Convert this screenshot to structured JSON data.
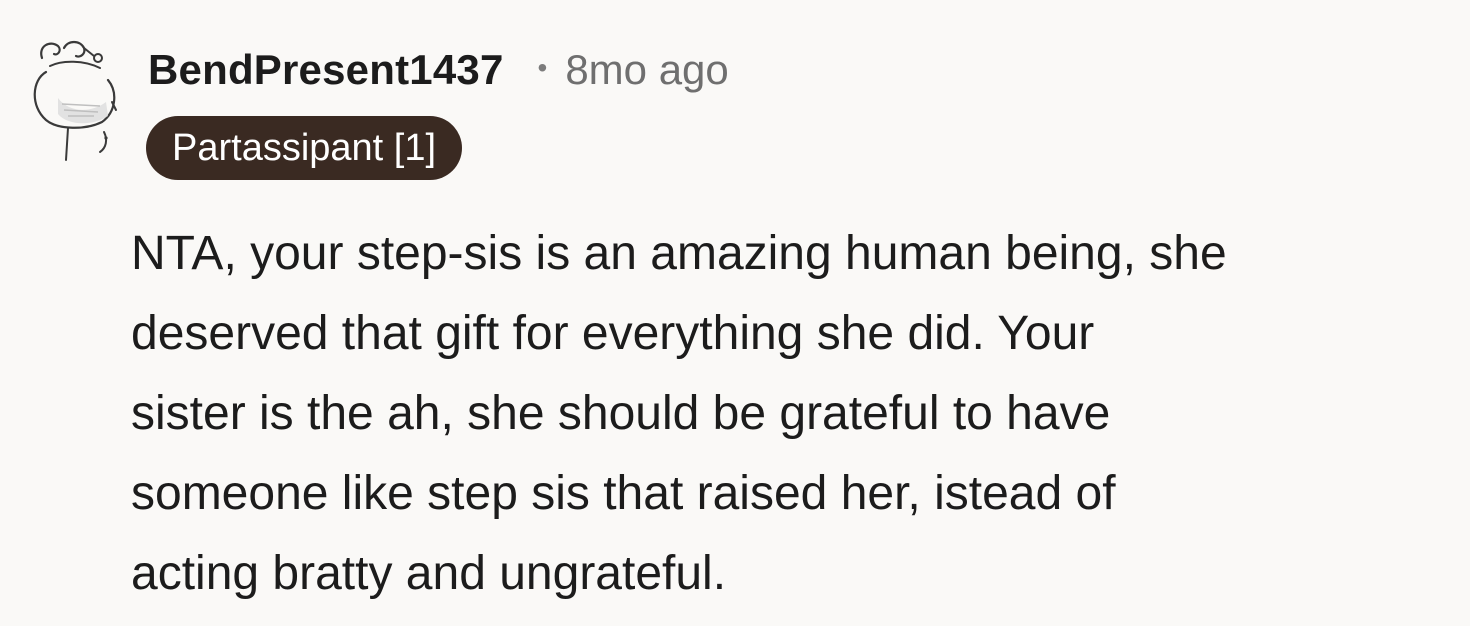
{
  "comment": {
    "username": "BendPresent1437",
    "separator": "•",
    "timestamp": "8mo ago",
    "flair": "Partassipant [1]",
    "body_lines": [
      "NTA, your step-sis is an amazing human being, she",
      "deserved that gift for everything she did. Your",
      "sister is the ah, she should be grateful to have",
      "someone like step sis that raised her, istead of",
      "acting bratty and ungrateful."
    ]
  },
  "avatar": {
    "icon": "snoo-avatar-icon"
  }
}
